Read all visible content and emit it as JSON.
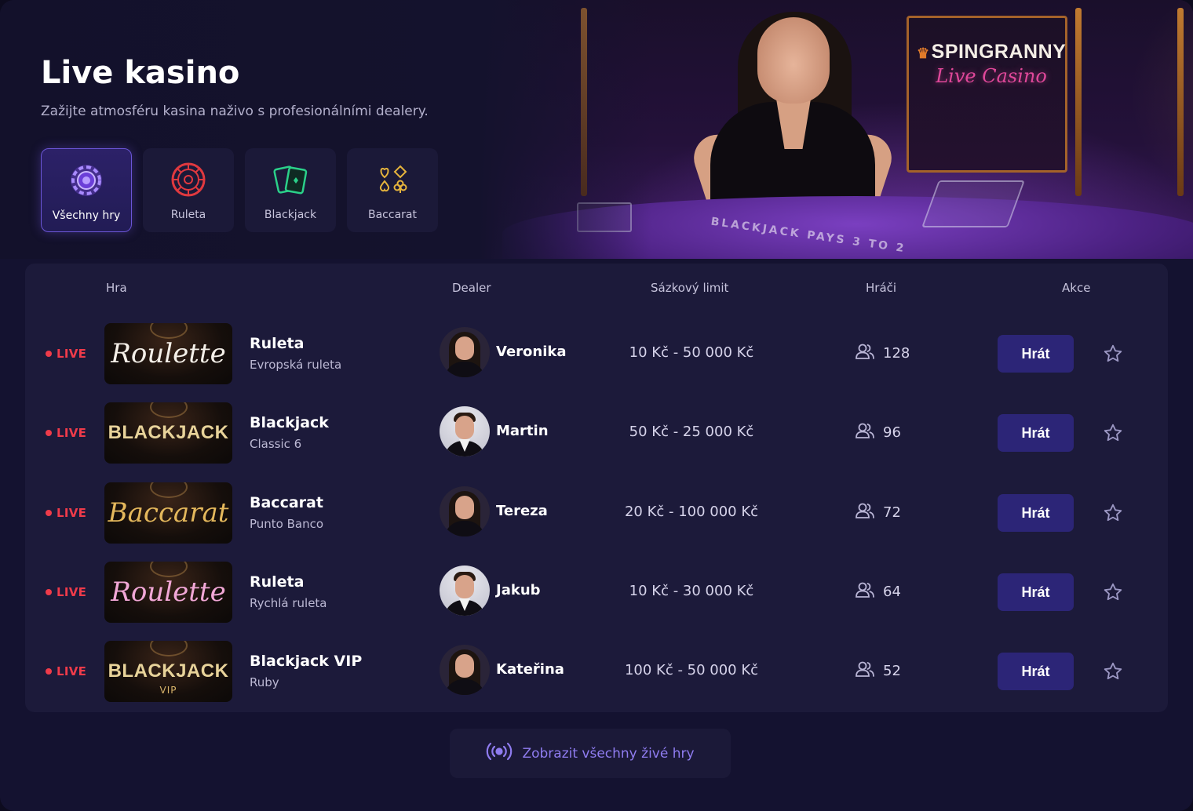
{
  "header": {
    "title": "Live kasino",
    "subtitle": "Zažijte atmosféru kasina naživo s profesionálními dealery."
  },
  "brand": {
    "name": "SPINGRANNY",
    "tagline": "Live Casino",
    "table_print": "BLACKJACK PAYS 3 TO 2"
  },
  "filters": [
    {
      "label": "Všechny hry",
      "icon": "chip-icon",
      "active": true
    },
    {
      "label": "Ruleta",
      "icon": "roulette-icon",
      "active": false
    },
    {
      "label": "Blackjack",
      "icon": "cards-icon",
      "active": false
    },
    {
      "label": "Baccarat",
      "icon": "card-suits-icon",
      "active": false
    }
  ],
  "table": {
    "columns": {
      "game": "Hra",
      "dealer": "Dealer",
      "limit": "Sázkový limit",
      "players": "Hráči",
      "actions": "Akce"
    },
    "live_label": "LIVE",
    "play_label": "Hrát",
    "rows": [
      {
        "thumb_text": "Roulette",
        "thumb_style": "script",
        "thumb_color": "#f4efe8",
        "thumb_extra": "",
        "name": "Ruleta",
        "variant": "Evropská ruleta",
        "dealer": "Veronika",
        "dealer_gender": "f",
        "limit": "10 Kč - 50 000 Kč",
        "players": "128"
      },
      {
        "thumb_text": "BLACKJACK",
        "thumb_style": "caps",
        "thumb_color": "#e8d39a",
        "thumb_extra": "",
        "name": "Blackjack",
        "variant": "Classic 6",
        "dealer": "Martin",
        "dealer_gender": "m",
        "limit": "50 Kč - 25 000 Kč",
        "players": "96"
      },
      {
        "thumb_text": "Baccarat",
        "thumb_style": "script",
        "thumb_color": "#e4b85c",
        "thumb_extra": "",
        "name": "Baccarat",
        "variant": "Punto Banco",
        "dealer": "Tereza",
        "dealer_gender": "f",
        "limit": "20 Kč - 100 000 Kč",
        "players": "72"
      },
      {
        "thumb_text": "Roulette",
        "thumb_style": "script",
        "thumb_color": "#f1a7d6",
        "thumb_extra": "",
        "name": "Ruleta",
        "variant": "Rychlá ruleta",
        "dealer": "Jakub",
        "dealer_gender": "m",
        "limit": "10 Kč - 30 000 Kč",
        "players": "64"
      },
      {
        "thumb_text": "BLACKJACK",
        "thumb_style": "caps",
        "thumb_color": "#e8d39a",
        "thumb_extra": "VIP",
        "name": "Blackjack VIP",
        "variant": "Ruby",
        "dealer": "Kateřina",
        "dealer_gender": "f",
        "limit": "100 Kč - 50 000 Kč",
        "players": "52"
      }
    ]
  },
  "show_all": {
    "label": "Zobrazit všechny živé hry",
    "icon": "broadcast-icon"
  },
  "colors": {
    "background": "#141230",
    "card": "#1c1a3a",
    "accent": "#8f7cf0",
    "button": "#2c2577",
    "live": "#ef3b4a"
  }
}
